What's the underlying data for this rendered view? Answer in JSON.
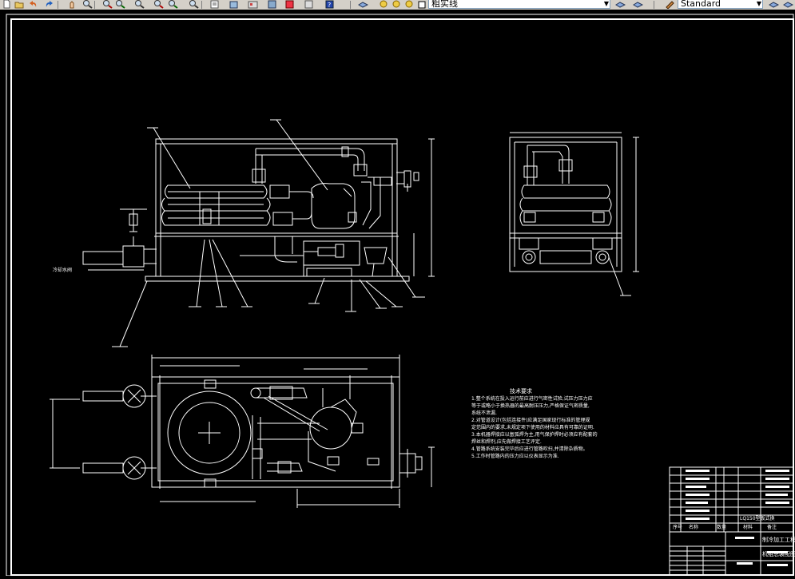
{
  "toolbar": {
    "linetype_value": "粗实线",
    "style_value": "Standard",
    "icons": [
      "new-icon",
      "open-icon",
      "undo-icon",
      "redo-icon",
      "pan-icon",
      "zoom-realtime-icon",
      "zoom-window-icon",
      "zoom-previous-icon",
      "properties-icon",
      "design-center-icon",
      "tool-palette-icon",
      "markup-icon",
      "help-icon",
      "layer-manager-icon",
      "layer-state-icon",
      "layer-previous-icon",
      "text-style-icon"
    ]
  },
  "drawing": {
    "label_water_inlet": "冷却水阀",
    "tech_req_title": "技术要求",
    "tech_req_lines": [
      "1.整个系统在投入运行前应进行气密性试验,试压力压力应",
      "  等于或略小于换热器的最高耐压压力,严格保证气密质量,",
      "  系统不泄漏.",
      "2.对管道设计(包括连接件)应满足国家现行标准的管理规",
      "  定范围内的要求,未规定项下使用的材料应具有可靠的证明.",
      "3.本机器焊接应以氩弧焊为主,用气保护焊时必须应有配套的",
      "  焊丝和焊剂,应先做焊接工艺评定.",
      "4.管路系统安装完毕后应进行管路吹扫,并清除杂质物。",
      "5.工作时管路内的压力应以仪表显示为准."
    ],
    "title_block": {
      "company": "制冷加工工程设计",
      "drawing_name": "机组总装配图",
      "header_cells": [
        "序号",
        "名称",
        "数量",
        "材料",
        "备注"
      ],
      "bom_row10_note": "LQ150型板式换"
    }
  },
  "colors": {
    "background": "#000000",
    "lines": "#ffffff",
    "toolbar": "#d4d0c8"
  }
}
